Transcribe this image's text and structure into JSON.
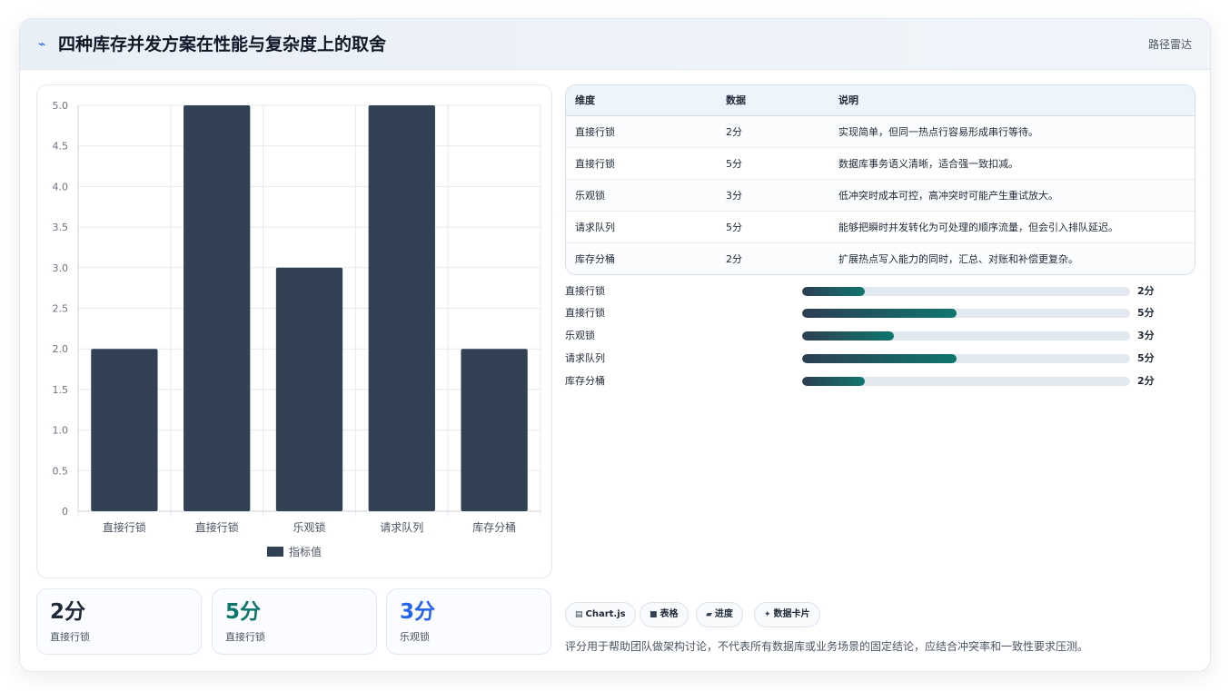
{
  "header": {
    "title": "四种库存并发方案在性能与复杂度上的取舍",
    "tag": "路径雷达"
  },
  "colors": {
    "bar": "#334155",
    "accent_teal": "#0f766e",
    "accent_blue": "#2563eb"
  },
  "chart_data": {
    "type": "bar",
    "categories": [
      "直接行锁",
      "直接行锁",
      "乐观锁",
      "请求队列",
      "库存分桶"
    ],
    "series": [
      {
        "name": "指标值",
        "values": [
          2,
          5,
          3,
          5,
          2
        ]
      }
    ],
    "ylim": [
      0,
      5
    ],
    "yticks": [
      "0",
      "0.5",
      "1.0",
      "1.5",
      "2.0",
      "2.5",
      "3.0",
      "3.5",
      "4.0",
      "4.5",
      "5.0"
    ],
    "grid": true,
    "legend": "bottom"
  },
  "stats": [
    {
      "value": "2分",
      "label": "直接行锁",
      "color": "#1f2937"
    },
    {
      "value": "5分",
      "label": "直接行锁",
      "color": "#0f766e"
    },
    {
      "value": "3分",
      "label": "乐观锁",
      "color": "#2563eb"
    }
  ],
  "table": {
    "headers": [
      "维度",
      "数据",
      "说明"
    ],
    "rows": [
      [
        "直接行锁",
        "2分",
        "实现简单，但同一热点行容易形成串行等待。"
      ],
      [
        "直接行锁",
        "5分",
        "数据库事务语义清晰，适合强一致扣减。"
      ],
      [
        "乐观锁",
        "3分",
        "低冲突时成本可控，高冲突时可能产生重试放大。"
      ],
      [
        "请求队列",
        "5分",
        "能够把瞬时并发转化为可处理的顺序流量，但会引入排队延迟。"
      ],
      [
        "库存分桶",
        "2分",
        "扩展热点写入能力的同时，汇总、对账和补偿更复杂。"
      ]
    ]
  },
  "progress": [
    {
      "label": "直接行锁",
      "value": "2分",
      "fraction": 0.19
    },
    {
      "label": "直接行锁",
      "value": "5分",
      "fraction": 0.47
    },
    {
      "label": "乐观锁",
      "value": "3分",
      "fraction": 0.28
    },
    {
      "label": "请求队列",
      "value": "5分",
      "fraction": 0.47
    },
    {
      "label": "库存分桶",
      "value": "2分",
      "fraction": 0.19
    }
  ],
  "chips": [
    {
      "icon": "chart-icon",
      "label": "Chart.js"
    },
    {
      "icon": "table-icon",
      "label": "表格"
    },
    {
      "icon": "progress-icon",
      "label": "进度"
    },
    {
      "icon": "sparkle-icon",
      "label": "数据卡片"
    }
  ],
  "note": "评分用于帮助团队做架构讨论，不代表所有数据库或业务场景的固定结论，应结合冲突率和一致性要求压测。"
}
